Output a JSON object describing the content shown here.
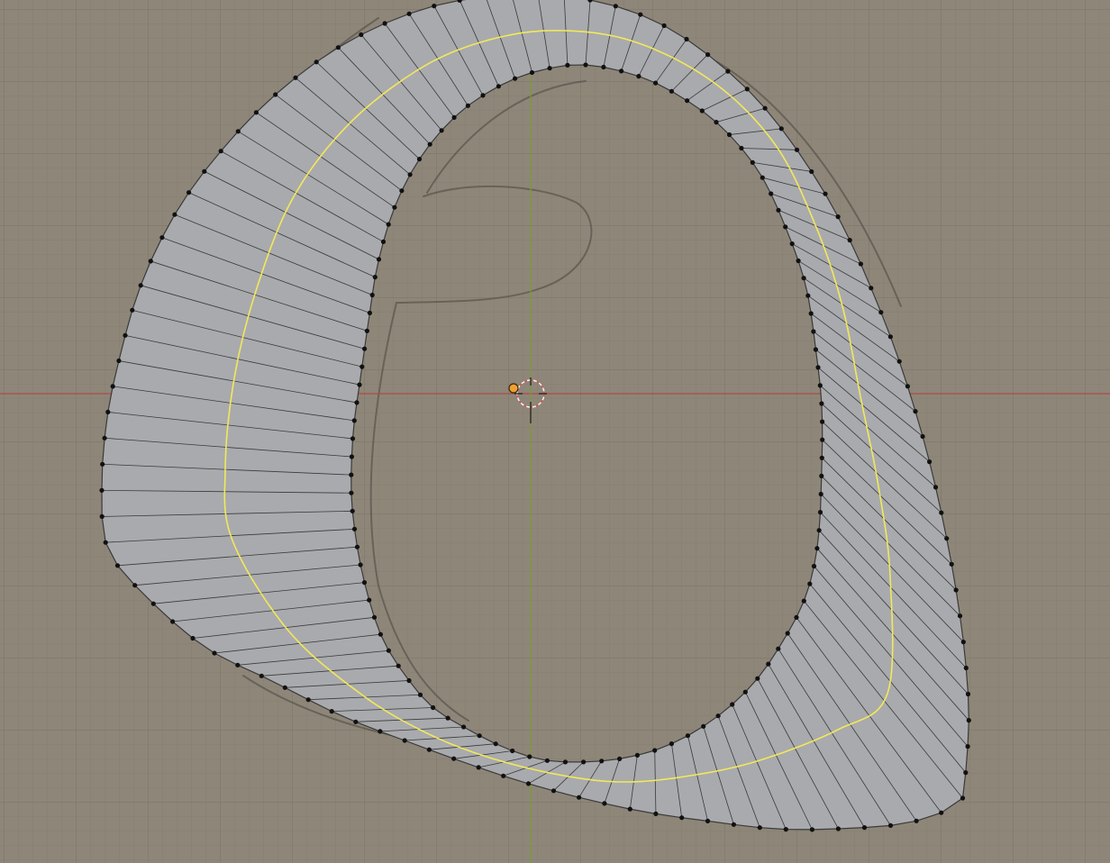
{
  "viewport": {
    "mode": "edit",
    "view": "orthographic",
    "background_image": "pencil-sketch-grid-paper",
    "colors": {
      "paper": "#8e8678",
      "grid_minor": "#7b7468",
      "grid_major": "#6d675c",
      "x_axis": "#b04a48",
      "y_axis": "#7c9a3d",
      "face_fill": "#a9aaad",
      "face_stroke": "#3a3a3a",
      "vertex": "#111111",
      "guide_curve": "#f2e85a",
      "sketch": "#4b463f",
      "origin_fill": "#f0a030",
      "cursor_red": "#d8544f"
    }
  },
  "mesh": {
    "outer_ring_vertices": 104,
    "inner_ring_vertices": 104
  },
  "scene_objects": {
    "origin_point": "object-origin-icon",
    "cursor": "3d-cursor-icon"
  }
}
